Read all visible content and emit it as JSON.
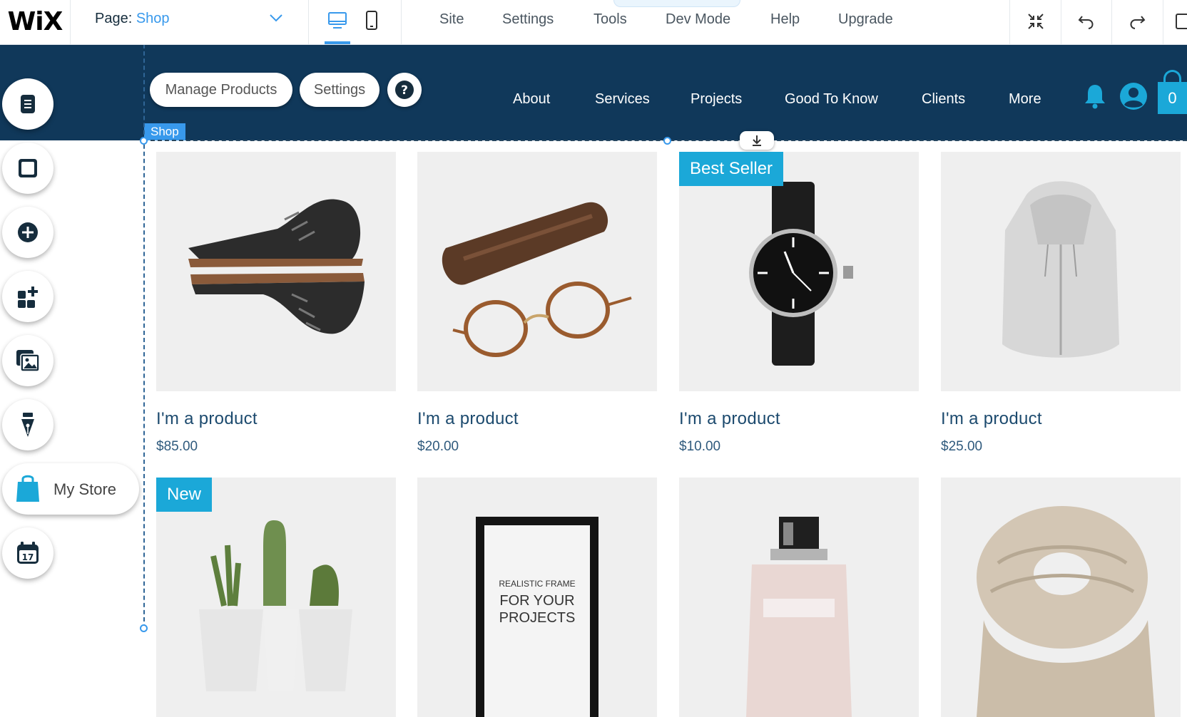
{
  "topbar": {
    "logo": "WiX",
    "page_label": "Page:",
    "page_value": "Shop",
    "menu": [
      "Site",
      "Settings",
      "Tools",
      "Dev Mode",
      "Help",
      "Upgrade"
    ]
  },
  "site_header": {
    "manage_products": "Manage Products",
    "settings": "Settings",
    "help": "?",
    "shop_tag": "Shop",
    "nav": [
      "About",
      "Services",
      "Projects",
      "Good To Know",
      "Clients",
      "More"
    ],
    "cart_count": "0"
  },
  "left_tools": {
    "my_store": "My Store"
  },
  "products": [
    {
      "name": "I'm a product",
      "price": "$85.00",
      "ribbon": ""
    },
    {
      "name": "I'm a product",
      "price": "$20.00",
      "ribbon": ""
    },
    {
      "name": "I'm a product",
      "price": "$10.00",
      "ribbon": "Best Seller"
    },
    {
      "name": "I'm a product",
      "price": "$25.00",
      "ribbon": ""
    },
    {
      "ribbon": "New"
    },
    {
      "frame_text": [
        "REALISTIC FRAME",
        "FOR YOUR",
        "PROJECTS"
      ]
    },
    {},
    {}
  ],
  "colors": {
    "accent": "#3899ec",
    "header_bg": "#10385a",
    "ribbon": "#1ba8d8"
  }
}
